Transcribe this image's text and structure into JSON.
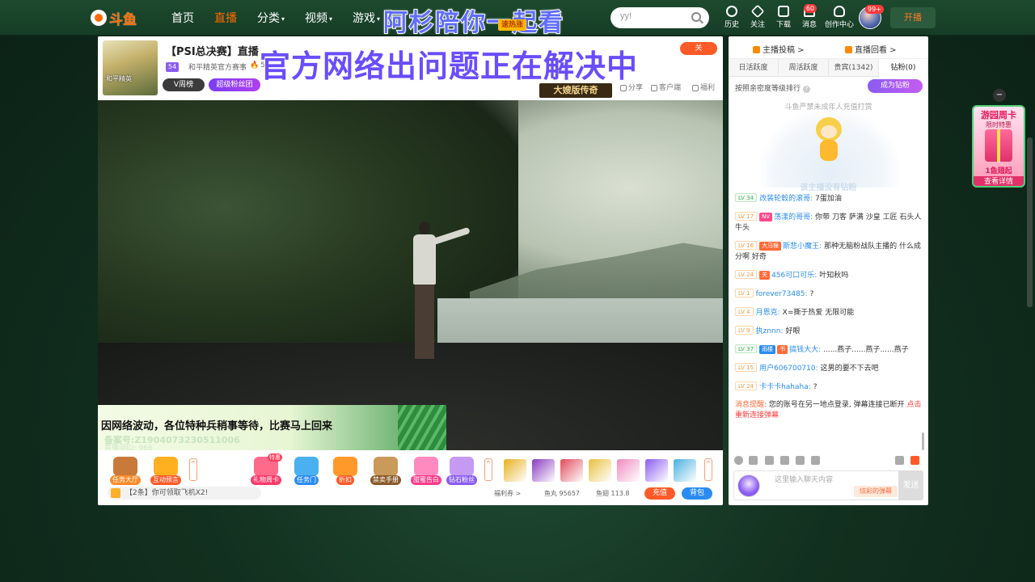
{
  "nav": {
    "logo_text": "斗鱼",
    "items": [
      {
        "label": "首页",
        "active": false,
        "has_caret": false
      },
      {
        "label": "直播",
        "active": true,
        "has_caret": false
      },
      {
        "label": "分类",
        "active": false,
        "has_caret": true
      },
      {
        "label": "视频",
        "active": false,
        "has_caret": true
      },
      {
        "label": "游戏",
        "active": false,
        "has_caret": true
      }
    ],
    "overlay_title": "阿杉陪你一起看",
    "hot_badge": "速热涨",
    "search_placeholder": "yy!",
    "tools": [
      {
        "label": "历史",
        "icon": "clock-icon"
      },
      {
        "label": "关注",
        "icon": "heart-icon"
      },
      {
        "label": "下载",
        "icon": "download-icon"
      },
      {
        "label": "消息",
        "icon": "bell-icon",
        "badge": "60"
      },
      {
        "label": "创作中心",
        "icon": "bulb-icon"
      }
    ],
    "avatar_badge": "99+",
    "broadcast_label": "开播"
  },
  "room": {
    "thumb_text": "和平精英",
    "title": "【PSI总决赛】直播",
    "level": "54",
    "streamer": "和平精英官方赛事",
    "heat": "51",
    "banner": "官方网络出问题正在解决中",
    "vweek_label": "V周榜",
    "fans_label": "超级粉丝团",
    "follow_label": "关",
    "show_badge": "大嫂版传奇",
    "actions": [
      "分享",
      "客户端",
      "福利"
    ]
  },
  "video": {
    "notice": "因网络波动，各位特种兵稍事等待，比赛马上回来",
    "notice_sub": "备案号:Z1904073230511006",
    "notice_sub2": "直播间ID: 966"
  },
  "toolbar": {
    "items": [
      {
        "label": "任务大厅",
        "color": "#ff8a2a",
        "bg": "#c97a3a"
      },
      {
        "label": "互动预言",
        "color": "#ff5a28",
        "bg": "#ffb020"
      },
      {
        "label": "礼物周卡",
        "color": "#ff3a6a",
        "bg": "#ff6a8a",
        "tag": "特惠"
      },
      {
        "label": "任务门",
        "color": "#2a8cf0",
        "bg": "#4ab0f0"
      },
      {
        "label": "折扣",
        "color": "#ff5a28",
        "bg": "#ff9a2a"
      },
      {
        "label": "禁卖手册",
        "color": "#8a5a2a",
        "bg": "#c99a5a"
      },
      {
        "label": "甜蜜告白",
        "color": "#ff3a8a",
        "bg": "#ff8ac0"
      },
      {
        "label": "钻石粉丝",
        "color": "#8a5cf2",
        "bg": "#c49af2"
      }
    ],
    "gifts": [
      "#e8b020",
      "#8a3ac0",
      "#e04a5a",
      "#e8c040",
      "#f08ac0",
      "#8a5cf2",
      "#4ab0e0"
    ],
    "bottom_msg": "【2条】你可领取飞机X2!",
    "welfare": "福利券",
    "yuwan_label": "鱼丸",
    "yuwan": "95657",
    "yuchi_label": "鱼翅",
    "yuchi": "113.8",
    "charge_label": "充值",
    "bag_label": "背包"
  },
  "panel": {
    "top_links": [
      "主播投稿",
      "直播回看"
    ],
    "tabs": [
      {
        "label": "日活跃度",
        "active": false
      },
      {
        "label": "周活跃度",
        "active": false
      },
      {
        "label": "贵宾(1342)",
        "active": false
      },
      {
        "label": "钻粉(0)",
        "active": true
      }
    ],
    "rank_label": "按照亲密度等级排行",
    "diamond_btn": "成为钻粉",
    "empty_note": "斗鱼严禁未成年人充值打赏",
    "empty_sub": "该主播没有钻粉",
    "chat": [
      {
        "lv": "LV 34",
        "lv_style": "green",
        "badges": [],
        "user": "改装轮毂的滚哥:",
        "msg": "7蛋加油"
      },
      {
        "lv": "LV 17",
        "lv_style": "orange",
        "badges": [
          {
            "text": "NV",
            "style": "pink"
          }
        ],
        "user": "荡漾的哥哥:",
        "msg": "你带 刀客 萨满 沙皇 工匠 石头人 牛头"
      },
      {
        "lv": "LV 16",
        "lv_style": "orange",
        "badges": [
          {
            "text": "大马猴",
            "style": ""
          }
        ],
        "user": "斯悲小魔王:",
        "msg": "那种无脑粉战队主播的 什么成分啊 好奇"
      },
      {
        "lv": "LV 24",
        "lv_style": "orange",
        "badges": [
          {
            "text": "关",
            "style": ""
          }
        ],
        "user": "456可口可乐:",
        "msg": "叶知秋吗"
      },
      {
        "lv": "LV 1",
        "lv_style": "orange",
        "badges": [],
        "user": "forever73485:",
        "msg": "?"
      },
      {
        "lv": "LV 4",
        "lv_style": "orange",
        "badges": [],
        "user": "月恩克:",
        "msg": "X=撕于热爱 无限可能"
      },
      {
        "lv": "LV 9",
        "lv_style": "orange",
        "badges": [],
        "user": "执znnn:",
        "msg": "好眼"
      },
      {
        "lv": "LV 37",
        "lv_style": "green",
        "badges": [
          {
            "text": "雨楼",
            "style": "blue"
          },
          {
            "text": "书",
            "style": ""
          }
        ],
        "user": "搞钱大大:",
        "msg": "......燕子......燕子......燕子"
      },
      {
        "lv": "LV 15",
        "lv_style": "orange",
        "badges": [],
        "user": "用户606700710:",
        "msg": "这男的要不下去吧"
      },
      {
        "lv": "LV 24",
        "lv_style": "orange",
        "badges": [],
        "user": "卡卡卡hahaha:",
        "msg": "?"
      }
    ],
    "alert_prefix": "消息提醒:",
    "alert_msg": "您的账号在另一地点登录, 弹幕连接已断开",
    "alert_link": "点击重新连接弹幕",
    "input_placeholder": "这里输入聊天内容",
    "color_tag": "炫彩的弹幕",
    "send_label": "发送"
  },
  "float_ad": {
    "title": "游园周卡",
    "sub": "限时特惠",
    "price": "1鱼翅起",
    "btn": "查看详情"
  }
}
